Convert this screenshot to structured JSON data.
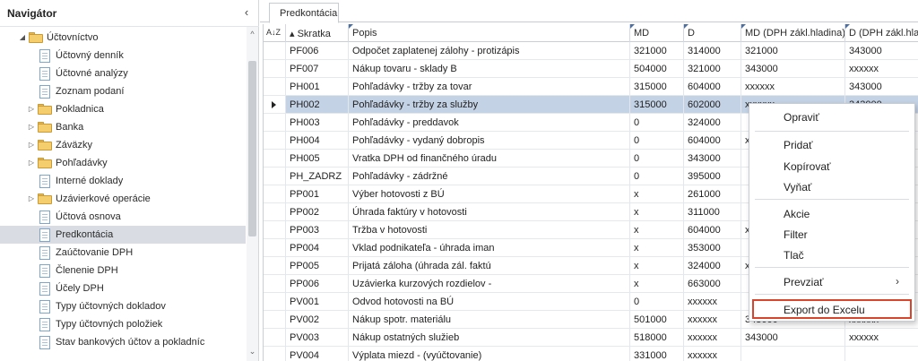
{
  "navigator": {
    "title": "Navigátor",
    "collapse_icon": "‹",
    "items": [
      {
        "label": "Účtovníctvo",
        "type": "folder",
        "expander": "◢",
        "level": 0
      },
      {
        "label": "Účtovný denník",
        "type": "page",
        "level": 1
      },
      {
        "label": "Účtovné analýzy",
        "type": "page",
        "level": 1
      },
      {
        "label": "Zoznam podaní",
        "type": "page",
        "level": 1
      },
      {
        "label": "Pokladnica",
        "type": "folder",
        "expander": "▷",
        "level": 1
      },
      {
        "label": "Banka",
        "type": "folder",
        "expander": "▷",
        "level": 1
      },
      {
        "label": "Záväzky",
        "type": "folder",
        "expander": "▷",
        "level": 1
      },
      {
        "label": "Pohľadávky",
        "type": "folder",
        "expander": "▷",
        "level": 1
      },
      {
        "label": "Interné doklady",
        "type": "page",
        "level": 1
      },
      {
        "label": "Uzávierkové operácie",
        "type": "folder",
        "expander": "▷",
        "level": 1
      },
      {
        "label": "Účtová osnova",
        "type": "page",
        "level": 1
      },
      {
        "label": "Predkontácia",
        "type": "page",
        "level": 1,
        "selected": true
      },
      {
        "label": "Zaúčtovanie DPH",
        "type": "page",
        "level": 1
      },
      {
        "label": "Členenie DPH",
        "type": "page",
        "level": 1
      },
      {
        "label": "Účely DPH",
        "type": "page",
        "level": 1
      },
      {
        "label": "Typy účtovných dokladov",
        "type": "page",
        "level": 1
      },
      {
        "label": "Typy účtovných položiek",
        "type": "page",
        "level": 1
      },
      {
        "label": "Stav bankových účtov a pokladníc",
        "type": "page",
        "level": 1
      }
    ]
  },
  "tab": {
    "label": "Predkontácia"
  },
  "grid": {
    "sort_indicator": "A↓Z",
    "columns": [
      {
        "label": "▴ Skratka"
      },
      {
        "label": "Popis"
      },
      {
        "label": "MD"
      },
      {
        "label": "D"
      },
      {
        "label": "MD (DPH zákl.hladina)"
      },
      {
        "label": "D (DPH zákl.hladina)"
      }
    ],
    "rows": [
      [
        "PF006",
        "Odpočet zaplatenej zálohy - protizápis",
        "321000",
        "314000",
        "321000",
        "343000"
      ],
      [
        "PF007",
        "Nákup tovaru - sklady B",
        "504000",
        "321000",
        "343000",
        "xxxxxx"
      ],
      [
        "PH001",
        "Pohľadávky - tržby za tovar",
        "315000",
        "604000",
        "xxxxxx",
        "343000"
      ],
      [
        "PH002",
        "Pohľadávky - tržby za služby",
        "315000",
        "602000",
        "xxxxxx",
        "343000"
      ],
      [
        "PH003",
        "Pohľadávky - preddavok",
        "0",
        "324000",
        "",
        ""
      ],
      [
        "PH004",
        "Pohľadávky - vydaný dobropis",
        "0",
        "604000",
        "xxxxxx",
        "343000"
      ],
      [
        "PH005",
        "Vratka DPH od finančného úradu",
        "0",
        "343000",
        "",
        ""
      ],
      [
        "PH_ZADRZ",
        "Pohľadávky - zádržné",
        "0",
        "395000",
        "",
        ""
      ],
      [
        "PP001",
        "Výber hotovosti z BÚ",
        "x",
        "261000",
        "",
        ""
      ],
      [
        "PP002",
        "Úhrada faktúry v hotovosti",
        "x",
        "311000",
        "",
        ""
      ],
      [
        "PP003",
        "Tržba v hotovosti",
        "x",
        "604000",
        "xxxxxx",
        "343000"
      ],
      [
        "PP004",
        "Vklad podnikateľa - úhrada iman",
        "x",
        "353000",
        "",
        ""
      ],
      [
        "PP005",
        "Prijatá záloha (úhrada zál. faktú",
        "x",
        "324000",
        "xxxxxx",
        "343000"
      ],
      [
        "PP006",
        "Uzávierka kurzových rozdielov -",
        "x",
        "663000",
        "",
        ""
      ],
      [
        "PV001",
        "Odvod hotovosti na BÚ",
        "0",
        "xxxxxx",
        "",
        ""
      ],
      [
        "PV002",
        "Nákup spotr. materiálu",
        "501000",
        "xxxxxx",
        "343000",
        "xxxxxx"
      ],
      [
        "PV003",
        "Nákup ostatných služieb",
        "518000",
        "xxxxxx",
        "343000",
        "xxxxxx"
      ],
      [
        "PV004",
        "Výplata miezd - (vyúčtovanie)",
        "331000",
        "xxxxxx",
        "",
        ""
      ]
    ],
    "selected_row": 3
  },
  "context_menu": {
    "items": [
      {
        "label": "Opraviť"
      },
      {
        "label": "Pridať"
      },
      {
        "label": "Kopírovať"
      },
      {
        "label": "Vyňať"
      },
      {
        "label": "Akcie"
      },
      {
        "label": "Filter"
      },
      {
        "label": "Tlač"
      },
      {
        "label": "Prevziať"
      },
      {
        "label": "Export do Excelu"
      }
    ],
    "submenu_arrow": "›"
  },
  "colors": {
    "selection_row": "#c4d2e6",
    "nav_selected": "#d9dde3",
    "highlight_border": "#d8452c",
    "folder": "#f4cd6c"
  }
}
